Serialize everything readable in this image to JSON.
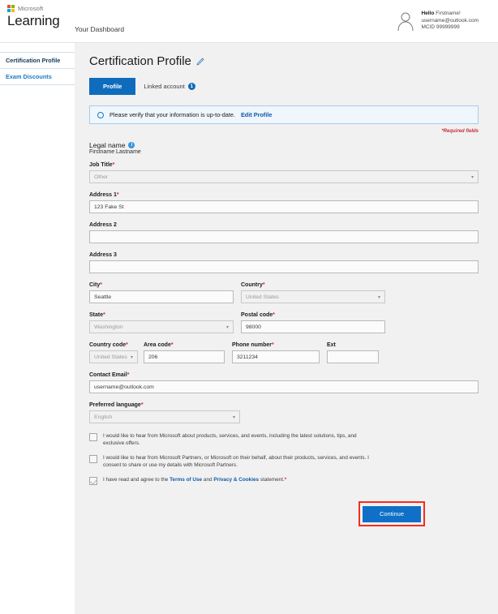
{
  "topbar": {
    "brand_microsoft": "Microsoft",
    "brand_learning": "Learning",
    "dashboard_link": "Your Dashboard",
    "user": {
      "hello_label": "Hello",
      "hello_name": "Firstname!",
      "email": "username@outlook.com",
      "mcid": "MCID 99999999"
    }
  },
  "sidebar": {
    "items": [
      {
        "label": "Certification Profile",
        "state": "active"
      },
      {
        "label": "Exam Discounts",
        "state": "link"
      }
    ]
  },
  "main": {
    "page_title": "Certification Profile",
    "edit_icon": "pencil-icon",
    "tabs": [
      {
        "label": "Profile",
        "active": true
      },
      {
        "label": "Linked account",
        "active": false,
        "badge": "1"
      }
    ],
    "notice": {
      "icon": "info-circle-icon",
      "text": "Please verify that your information is up-to-date.",
      "link": "Edit Profile"
    },
    "required_note": "*Required fields",
    "legal_name": {
      "label": "Legal name",
      "info_icon": "info-icon",
      "value": "Firstname Lastname"
    },
    "fields": {
      "job_title": {
        "label": "Job Title",
        "required": "*",
        "value": "Other",
        "type": "select",
        "disabled": true
      },
      "address1": {
        "label": "Address 1",
        "required": "*",
        "value": "123 Fake St",
        "type": "text",
        "disabled": false
      },
      "address2": {
        "label": "Address 2",
        "required": "",
        "value": "",
        "type": "text",
        "disabled": false
      },
      "address3": {
        "label": "Address 3",
        "required": "",
        "value": "",
        "type": "text",
        "disabled": false
      },
      "city": {
        "label": "City",
        "required": "*",
        "value": "Seattle",
        "type": "text",
        "disabled": false
      },
      "country": {
        "label": "Country",
        "required": "*",
        "value": "United States",
        "type": "select",
        "disabled": true
      },
      "state": {
        "label": "State",
        "required": "*",
        "value": "Washington",
        "type": "select",
        "disabled": true
      },
      "postal_code": {
        "label": "Postal code",
        "required": "*",
        "value": "98000",
        "type": "text",
        "disabled": false
      },
      "country_code": {
        "label": "Country code",
        "required": "*",
        "value": "United States",
        "type": "select",
        "disabled": true
      },
      "area_code": {
        "label": "Area code",
        "required": "*",
        "value": "206",
        "type": "text",
        "disabled": false
      },
      "phone_number": {
        "label": "Phone number",
        "required": "*",
        "value": "3211234",
        "type": "text",
        "disabled": false
      },
      "ext": {
        "label": "Ext",
        "required": "",
        "value": "",
        "type": "text",
        "disabled": false
      },
      "contact_email": {
        "label": "Contact Email",
        "required": "*",
        "value": "username@outlook.com",
        "type": "text",
        "disabled": false
      },
      "preferred_language": {
        "label": "Preferred language",
        "required": "*",
        "value": "English",
        "type": "select",
        "disabled": true
      }
    },
    "consents": [
      {
        "checked": false,
        "text": "I would like to hear from Microsoft about products, services, and events, including the latest solutions, tips, and exclusive offers."
      },
      {
        "checked": false,
        "text": "I would like to hear from Microsoft Partners, or Microsoft on their behalf, about their products, services, and events. I consent to share or use my details with Microsoft Partners."
      }
    ],
    "terms": {
      "checked": true,
      "pre": "I have read and agree to the",
      "link1": "Terms of Use",
      "mid": "and",
      "link2": "Privacy & Cookies",
      "post": "statement.",
      "required": "*"
    },
    "continue_label": "Continue"
  },
  "colors": {
    "brand_blue": "#0f6cbd",
    "button_blue": "#1070c8",
    "link_blue": "#0f5aa8",
    "required_red": "#c4303b",
    "highlight_red": "#fb2b1b",
    "panel_gray": "#f1f1f1"
  }
}
